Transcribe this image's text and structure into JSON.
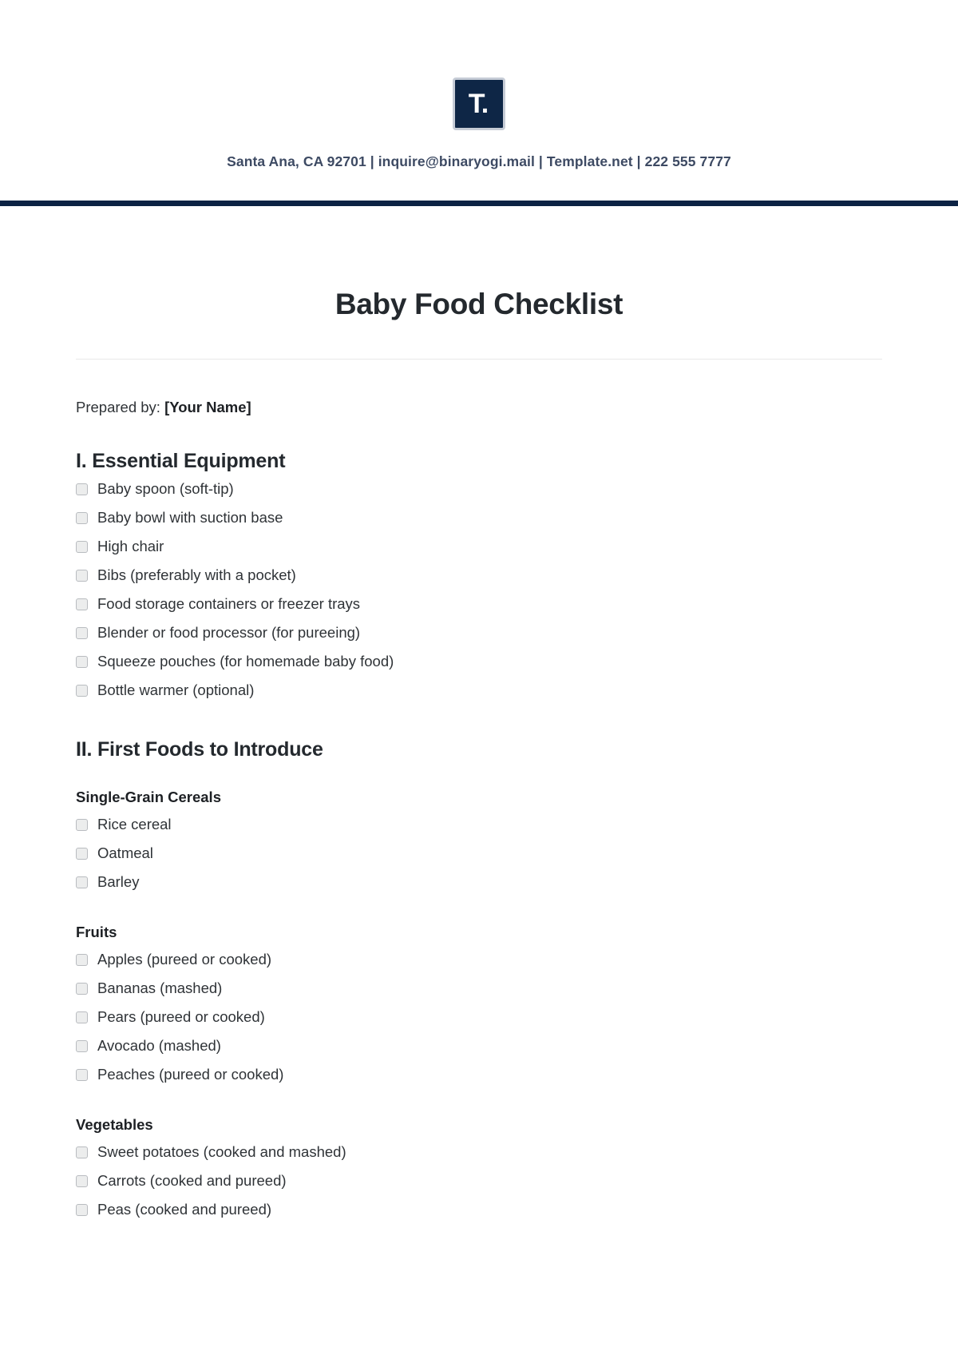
{
  "letterhead": {
    "logo_text": "T.",
    "logo_icon": "template-net-logo-icon",
    "contact_line": "Santa Ana, CA 92701 | inquire@binaryogi.mail | Template.net | 222 555 7777",
    "bar_color": "#0c2344",
    "logo_bg_color": "#0e2646"
  },
  "document": {
    "title": "Baby Food Checklist",
    "prepared_by_label": "Prepared by:",
    "prepared_by_value": "[Your Name]"
  },
  "sections": [
    {
      "heading": "I. Essential Equipment",
      "items": [
        "Baby spoon (soft-tip)",
        "Baby bowl with suction base",
        "High chair",
        "Bibs (preferably with a pocket)",
        "Food storage containers or freezer trays",
        "Blender or food processor (for pureeing)",
        "Squeeze pouches (for homemade baby food)",
        "Bottle warmer (optional)"
      ]
    },
    {
      "heading": "II. First Foods to Introduce",
      "subsections": [
        {
          "heading": "Single-Grain Cereals",
          "items": [
            "Rice cereal",
            "Oatmeal",
            "Barley"
          ]
        },
        {
          "heading": "Fruits",
          "items": [
            "Apples (pureed or cooked)",
            "Bananas (mashed)",
            "Pears (pureed or cooked)",
            "Avocado (mashed)",
            "Peaches (pureed or cooked)"
          ]
        },
        {
          "heading": "Vegetables",
          "items": [
            "Sweet potatoes (cooked and mashed)",
            "Carrots (cooked and pureed)",
            "Peas (cooked and pureed)"
          ]
        }
      ]
    }
  ]
}
